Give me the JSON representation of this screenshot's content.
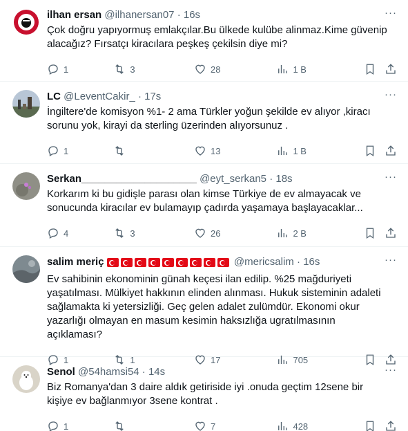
{
  "colors": {
    "text": "#0f1419",
    "muted": "#536471",
    "divider": "#eff3f4"
  },
  "icons": {
    "reply": "reply-icon",
    "retweet": "retweet-icon",
    "like": "heart-icon",
    "views": "views-icon",
    "bookmark": "bookmark-icon",
    "share": "share-icon",
    "more": "more-icon"
  },
  "more_label": "···",
  "tweets": [
    {
      "name": "ilhan ersan",
      "handle": "@ilhanersan07",
      "dot": "·",
      "time": "16s",
      "text": "Çok doğru yapıyormuş emlakçılar.Bu ülkede kulübe alinmaz.Kime güvenip alacağız? Fırsatçı kiracılara peşkeş çekilsin diye mi?",
      "replies": "1",
      "retweets": "3",
      "likes": "28",
      "views": "1 B"
    },
    {
      "name": "LC",
      "handle": "@LeventCakir_",
      "dot": "·",
      "time": "17s",
      "text": "İngiltere'de komisyon  %1- 2 ama Türkler yoğun şekilde ev alıyor ,kiracı sorunu yok, kirayi da sterling üzerinden alıyorsunuz .",
      "replies": "1",
      "retweets": "",
      "likes": "13",
      "views": "1 B"
    },
    {
      "name": "Serkan____________________",
      "handle": "@eyt_serkan5",
      "dot": "·",
      "time": "18s",
      "text": "Korkarım ki bu gidişle parası olan kimse Türkiye de ev almayacak ve sonucunda kiracılar ev bulamayıp çadırda yaşamaya başlayacaklar...",
      "replies": "4",
      "retweets": "3",
      "likes": "26",
      "views": "2 B"
    },
    {
      "name": "salim meriç",
      "handle": "@mericsalim",
      "dot": "·",
      "time": "16s",
      "text": "Ev sahibinin ekonominin günah keçesi ilan edilip. %25 mağduriyeti yaşatılması. Mülkiyet hakkının elinden alınması. Hukuk sisteminin adaleti sağlamakta ki yetersizliği. Geç gelen adalet zulümdür. Ekonomi okur yazarlığı olmayan en masum kesimin haksızlığa ugratılmasının açıklaması?",
      "replies": "1",
      "retweets": "1",
      "likes": "17",
      "views": "705"
    },
    {
      "name": "Senol",
      "handle": "@54hamsi54",
      "dot": "·",
      "time": "14s",
      "text": "Biz Romanya'dan 3 daire aldık getiriside iyi .onuda geçtim 12sene bir kişiye ev bağlanmıyor 3sene kontrat .",
      "replies": "1",
      "retweets": "",
      "likes": "7",
      "views": "428"
    }
  ]
}
